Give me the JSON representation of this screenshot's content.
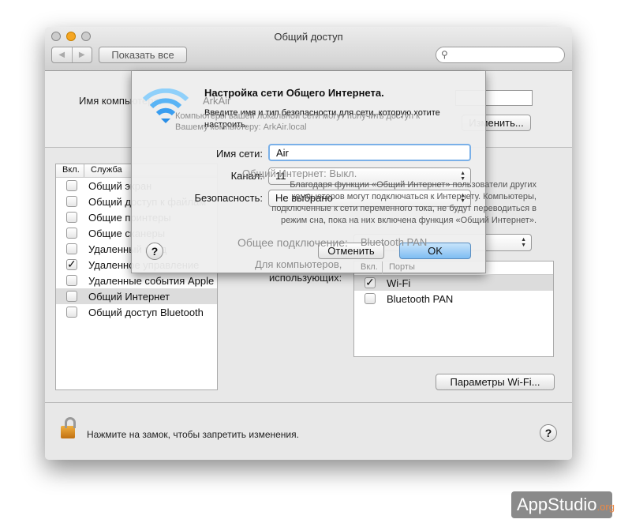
{
  "window": {
    "title": "Общий доступ",
    "show_all": "Показать все",
    "search_placeholder": ""
  },
  "computer": {
    "name_label": "Имя компьютера:",
    "name_value": "ArkAir",
    "note": "Компьютеры вашей локальной сети могут получить доступ к Вашему компьютеру: ArkAir.local",
    "edit_button": "Изменить..."
  },
  "services": {
    "col_on": "Вкл.",
    "col_service": "Служба",
    "items": [
      {
        "label": "Общий экран",
        "checked": false
      },
      {
        "label": "Общий доступ к файлам",
        "checked": false
      },
      {
        "label": "Общие принтеры",
        "checked": false
      },
      {
        "label": "Общие сканеры",
        "checked": false
      },
      {
        "label": "Удаленный вход",
        "checked": false
      },
      {
        "label": "Удаленное управление",
        "checked": true
      },
      {
        "label": "Удаленные события Apple",
        "checked": false
      },
      {
        "label": "Общий Интернет",
        "checked": false,
        "selected": true
      },
      {
        "label": "Общий доступ Bluetooth",
        "checked": false
      }
    ]
  },
  "internet": {
    "status": "Общий Интернет: Выкл.",
    "description": "Благодаря функции «Общий Интернет» пользователи других компьютеров могут подключаться к Интернету. Компьютеры, подключенные к сети переменного тока, не будут переводиться в режим сна, пока на них включена функция «Общий Интернет».",
    "share_from_label": "Общее подключение:",
    "share_from_value": "Bluetooth PAN",
    "to_label_1": "Для компьютеров,",
    "to_label_2": "использующих:",
    "ports_col_on": "Вкл.",
    "ports_col_ports": "Порты",
    "ports": [
      {
        "label": "Wi-Fi",
        "checked": true
      },
      {
        "label": "Bluetooth PAN",
        "checked": false
      }
    ],
    "wifi_options_button": "Параметры Wi-Fi..."
  },
  "footer": {
    "lock_text": "Нажмите на замок, чтобы запретить изменения.",
    "help": "?"
  },
  "dialog": {
    "title": "Настройка сети Общего Интернета.",
    "subtitle": "Введите имя и тип безопасности для сети, которую хотите настроить.",
    "network_name_label": "Имя сети:",
    "network_name_value": "Air",
    "channel_label": "Канал:",
    "channel_value": "11",
    "security_label": "Безопасность:",
    "security_value": "Не выбрано",
    "cancel": "Отменить",
    "ok": "OK",
    "help": "?"
  },
  "watermark": {
    "text": "AppStudio",
    "suffix": ".org"
  },
  "colors": {
    "ok_button": "#8cc4f4",
    "wifi_icon": "#3a9ef0",
    "selection": "#dcdcdc"
  }
}
